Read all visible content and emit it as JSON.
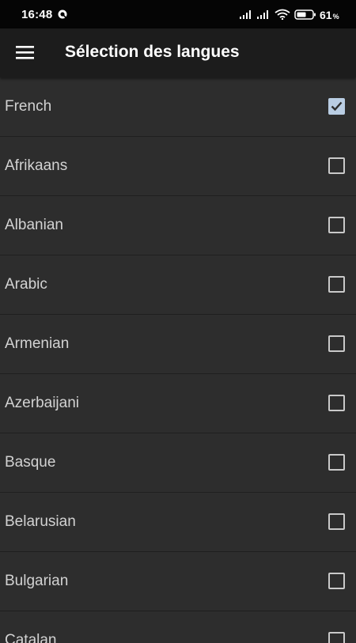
{
  "status_bar": {
    "time": "16:48",
    "battery_level": "61",
    "battery_unit": "%",
    "icons": [
      "notification-icon",
      "signal-icon",
      "signal-icon",
      "wifi-icon",
      "battery-icon"
    ]
  },
  "app_bar": {
    "menu_icon": "hamburger-menu-icon",
    "title": "Sélection des langues"
  },
  "languages": [
    {
      "label": "French",
      "checked": true
    },
    {
      "label": "Afrikaans",
      "checked": false
    },
    {
      "label": "Albanian",
      "checked": false
    },
    {
      "label": "Arabic",
      "checked": false
    },
    {
      "label": "Armenian",
      "checked": false
    },
    {
      "label": "Azerbaijani",
      "checked": false
    },
    {
      "label": "Basque",
      "checked": false
    },
    {
      "label": "Belarusian",
      "checked": false
    },
    {
      "label": "Bulgarian",
      "checked": false
    },
    {
      "label": "Catalan",
      "checked": false
    }
  ],
  "colors": {
    "status_bar_bg": "#050505",
    "app_bar_bg": "#1c1c1c",
    "list_bg": "#2d2d2d",
    "checkbox_checked": "#b9cde3"
  }
}
